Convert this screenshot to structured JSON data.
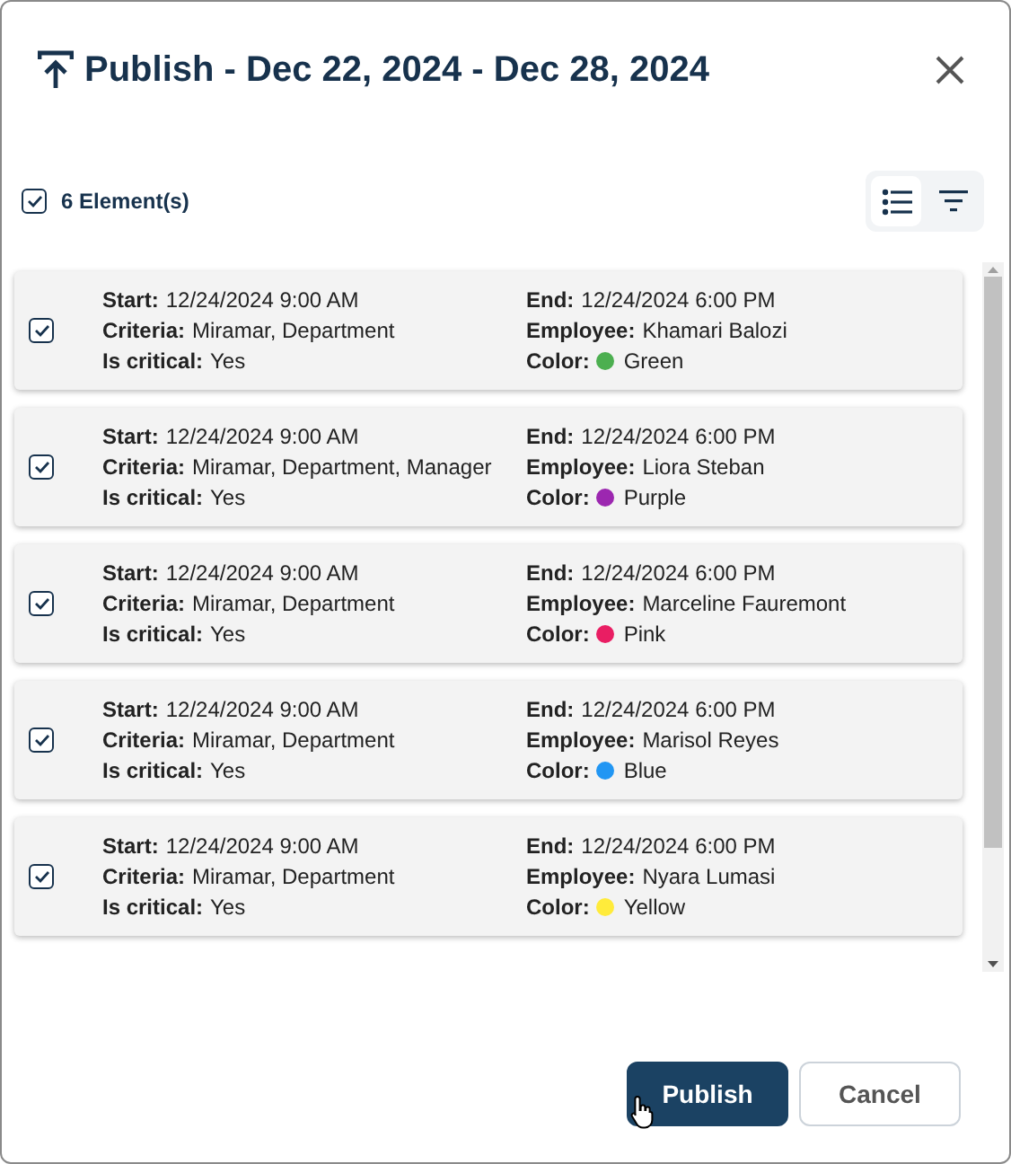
{
  "dialog": {
    "title": "Publish - Dec 22, 2024 - Dec 28, 2024"
  },
  "toolbar": {
    "select_all": {
      "label": "6 Element(s)",
      "checked": true
    },
    "views": [
      {
        "kind": "list",
        "selected": true
      },
      {
        "kind": "filter",
        "selected": false
      }
    ]
  },
  "cards": [
    {
      "checked": true,
      "left": [
        {
          "label": "Start:",
          "value": "12/24/2024 9:00 AM"
        },
        {
          "label": "Criteria:",
          "value": "Miramar, Department"
        },
        {
          "label": "Is critical:",
          "value": "Yes"
        }
      ],
      "right": [
        {
          "kind": "text",
          "label": "End:",
          "value": "12/24/2024 6:00 PM"
        },
        {
          "kind": "text",
          "label": "Employee:",
          "value": "Khamari Balozi"
        },
        {
          "kind": "color",
          "label": "Color:",
          "value": "Green",
          "color": "#4caf50"
        }
      ]
    },
    {
      "checked": true,
      "left": [
        {
          "label": "Start:",
          "value": "12/24/2024 9:00 AM"
        },
        {
          "label": "Criteria:",
          "value": "Miramar, Department, Manager"
        },
        {
          "label": "Is critical:",
          "value": "Yes"
        }
      ],
      "right": [
        {
          "kind": "text",
          "label": "End:",
          "value": "12/24/2024 6:00 PM"
        },
        {
          "kind": "text",
          "label": "Employee:",
          "value": "Liora Steban"
        },
        {
          "kind": "color",
          "label": "Color:",
          "value": "Purple",
          "color": "#9c27b0"
        }
      ]
    },
    {
      "checked": true,
      "left": [
        {
          "label": "Start:",
          "value": "12/24/2024 9:00 AM"
        },
        {
          "label": "Criteria:",
          "value": "Miramar, Department"
        },
        {
          "label": "Is critical:",
          "value": "Yes"
        }
      ],
      "right": [
        {
          "kind": "text",
          "label": "End:",
          "value": "12/24/2024 6:00 PM"
        },
        {
          "kind": "text",
          "label": "Employee:",
          "value": "Marceline Fauremont"
        },
        {
          "kind": "color",
          "label": "Color:",
          "value": "Pink",
          "color": "#e91e63"
        }
      ]
    },
    {
      "checked": true,
      "left": [
        {
          "label": "Start:",
          "value": "12/24/2024 9:00 AM"
        },
        {
          "label": "Criteria:",
          "value": "Miramar, Department"
        },
        {
          "label": "Is critical:",
          "value": "Yes"
        }
      ],
      "right": [
        {
          "kind": "text",
          "label": "End:",
          "value": "12/24/2024 6:00 PM"
        },
        {
          "kind": "text",
          "label": "Employee:",
          "value": "Marisol Reyes"
        },
        {
          "kind": "color",
          "label": "Color:",
          "value": "Blue",
          "color": "#2196f3"
        }
      ]
    },
    {
      "checked": true,
      "left": [
        {
          "label": "Start:",
          "value": "12/24/2024 9:00 AM"
        },
        {
          "label": "Criteria:",
          "value": "Miramar, Department"
        },
        {
          "label": "Is critical:",
          "value": "Yes"
        }
      ],
      "right": [
        {
          "kind": "text",
          "label": "End:",
          "value": "12/24/2024 6:00 PM"
        },
        {
          "kind": "text",
          "label": "Employee:",
          "value": "Nyara Lumasi"
        },
        {
          "kind": "color",
          "label": "Color:",
          "value": "Yellow",
          "color": "#ffeb3b"
        }
      ]
    }
  ],
  "buttons": [
    {
      "kind": "primary",
      "label": "Publish"
    },
    {
      "kind": "secondary",
      "label": "Cancel"
    }
  ]
}
